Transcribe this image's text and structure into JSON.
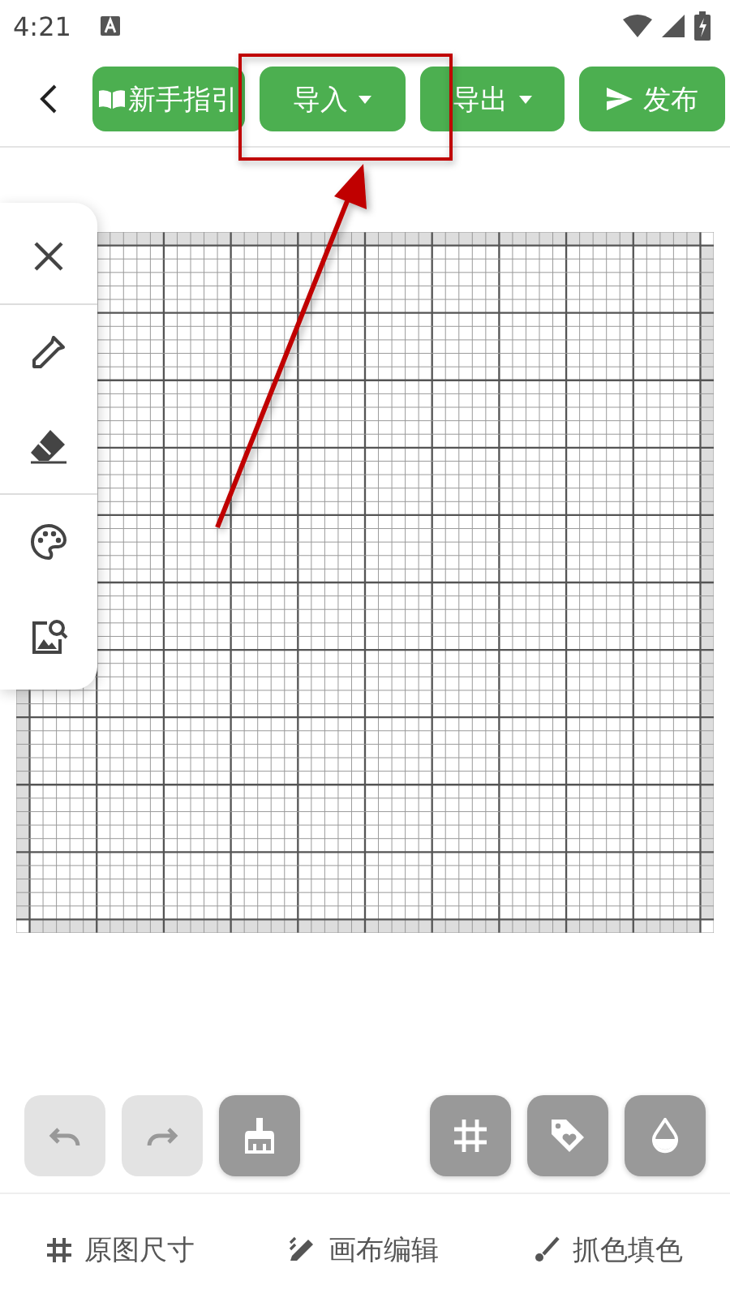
{
  "status_bar": {
    "time": "4:21"
  },
  "toolbar": {
    "buttons": [
      {
        "label": "新手指引",
        "kind": "guide",
        "dropdown": false
      },
      {
        "label": "导入",
        "kind": "plain",
        "dropdown": true
      },
      {
        "label": "导出",
        "kind": "plain",
        "dropdown": true
      },
      {
        "label": "发布",
        "kind": "send",
        "dropdown": false
      }
    ]
  },
  "side_tools": [
    {
      "kind": "close",
      "divider_after": true
    },
    {
      "kind": "dropper",
      "divider_after": false
    },
    {
      "kind": "eraser",
      "divider_after": true
    },
    {
      "kind": "palette",
      "divider_after": false
    },
    {
      "kind": "image-search",
      "divider_after": false
    }
  ],
  "left_actions": [
    {
      "kind": "undo",
      "disabled": true
    },
    {
      "kind": "redo",
      "disabled": true
    },
    {
      "kind": "clean",
      "disabled": false
    }
  ],
  "right_actions": [
    {
      "kind": "grid",
      "disabled": false
    },
    {
      "kind": "tag",
      "disabled": false
    },
    {
      "kind": "drop",
      "disabled": false
    }
  ],
  "bottom_tabs": [
    {
      "label": "原图尺寸",
      "kind": "hash"
    },
    {
      "label": "画布编辑",
      "kind": "edit"
    },
    {
      "label": "抓色填色",
      "kind": "brush"
    }
  ]
}
